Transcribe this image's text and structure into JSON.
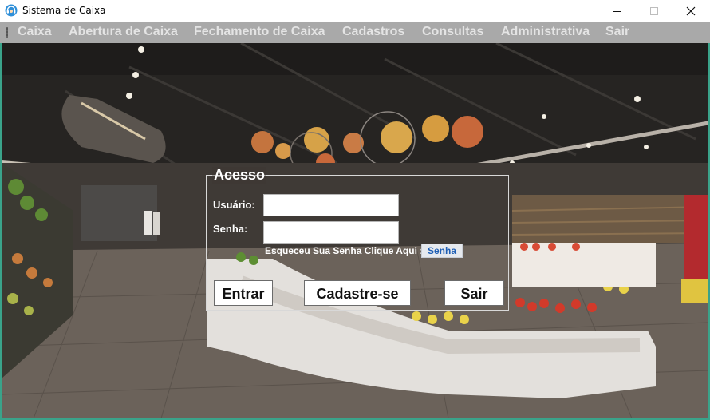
{
  "window": {
    "title": "Sistema de Caixa",
    "icon": "support-headset-icon",
    "controls": {
      "minimize": "minimize-icon",
      "maximize": "maximize-icon",
      "close": "close-icon"
    }
  },
  "menu": {
    "items": [
      {
        "label": "Caixa"
      },
      {
        "label": "Abertura de Caixa"
      },
      {
        "label": "Fechamento de Caixa"
      },
      {
        "label": "Cadastros"
      },
      {
        "label": "Consultas"
      },
      {
        "label": "Administrativa"
      },
      {
        "label": "Sair"
      }
    ]
  },
  "login": {
    "legend": "Acesso",
    "usuario_label": "Usuário:",
    "usuario_value": "",
    "senha_label": "Senha:",
    "senha_value": "",
    "forgot_text": "Esqueceu Sua Senha Clique Aqui :",
    "forgot_link": "Senha",
    "buttons": {
      "entrar": "Entrar",
      "cadastre": "Cadastre-se",
      "sair": "Sair"
    }
  },
  "colors": {
    "menubar_bg": "#a9a9a9",
    "menu_text": "#e4e4e4",
    "window_border": "#3aa38a",
    "link_text": "#1f5fb5"
  },
  "background": "supermarket-interior-photo"
}
